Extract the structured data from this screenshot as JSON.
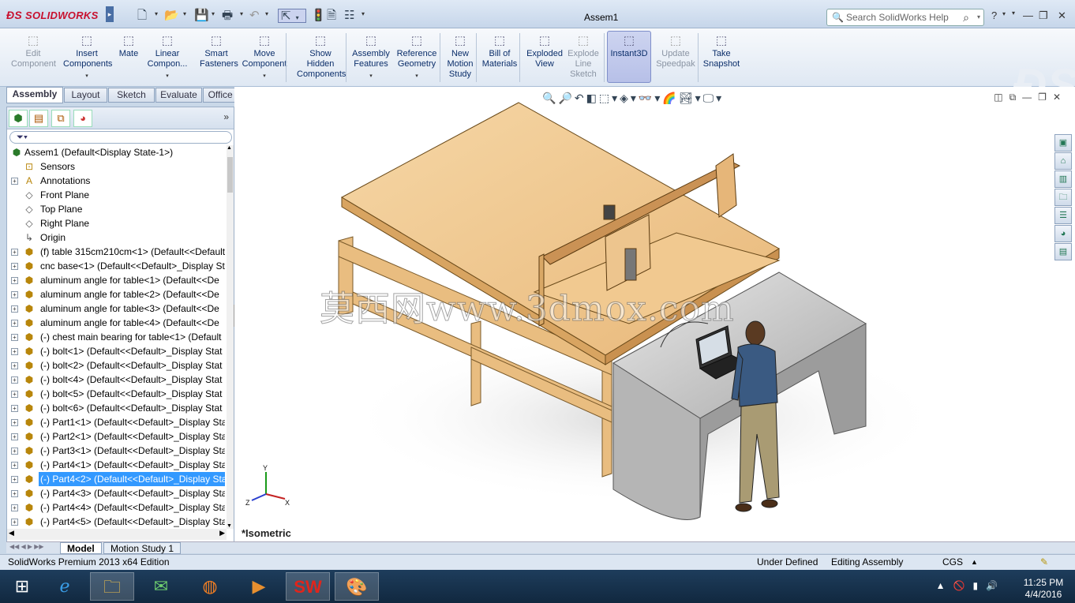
{
  "app": {
    "title": "Assem1",
    "brand": "SOLIDWORKS",
    "edition": "SolidWorks Premium 2013 x64 Edition"
  },
  "search": {
    "placeholder": "Search SolidWorks Help"
  },
  "command_manager": {
    "tools": [
      {
        "label1": "Edit",
        "label2": "Component",
        "label3": "",
        "icon": "edit-component-icon",
        "disabled": true
      },
      {
        "label1": "Insert",
        "label2": "Components",
        "label3": "",
        "icon": "insert-components-icon",
        "dropdown": true
      },
      {
        "label1": "Mate",
        "label2": "",
        "label3": "",
        "icon": "mate-icon"
      },
      {
        "label1": "Linear",
        "label2": "Compon...",
        "label3": "",
        "icon": "linear-pattern-icon",
        "dropdown": true
      },
      {
        "label1": "Smart",
        "label2": "Fasteners",
        "label3": "",
        "icon": "smart-fasteners-icon"
      },
      {
        "label1": "Move",
        "label2": "Component",
        "label3": "",
        "icon": "move-component-icon",
        "dropdown": true
      },
      {
        "label1": "Show",
        "label2": "Hidden",
        "label3": "Components",
        "icon": "show-hidden-icon"
      },
      {
        "label1": "Assembly",
        "label2": "Features",
        "label3": "",
        "icon": "assembly-features-icon",
        "dropdown": true
      },
      {
        "label1": "Reference",
        "label2": "Geometry",
        "label3": "",
        "icon": "reference-geometry-icon",
        "dropdown": true
      },
      {
        "label1": "New",
        "label2": "Motion",
        "label3": "Study",
        "icon": "motion-study-icon"
      },
      {
        "label1": "Bill of",
        "label2": "Materials",
        "label3": "",
        "icon": "bom-icon"
      },
      {
        "label1": "Exploded",
        "label2": "View",
        "label3": "",
        "icon": "exploded-view-icon"
      },
      {
        "label1": "Explode",
        "label2": "Line",
        "label3": "Sketch",
        "icon": "explode-line-icon",
        "disabled": true
      },
      {
        "label1": "Instant3D",
        "label2": "",
        "label3": "",
        "icon": "instant3d-icon",
        "active": true
      },
      {
        "label1": "Update",
        "label2": "Speedpak",
        "label3": "",
        "icon": "speedpak-icon",
        "disabled": true
      },
      {
        "label1": "Take",
        "label2": "Snapshot",
        "label3": "",
        "icon": "snapshot-icon"
      }
    ],
    "tabs": [
      "Assembly",
      "Layout",
      "Sketch",
      "Evaluate",
      "Office Products"
    ]
  },
  "tree": {
    "root": "Assem1  (Default<Display State-1>)",
    "items": [
      {
        "label": "Sensors",
        "icon": "sensors-icon",
        "expand": false
      },
      {
        "label": "Annotations",
        "icon": "annotations-icon",
        "expand": true
      },
      {
        "label": "Front Plane",
        "icon": "plane-icon",
        "expand": false
      },
      {
        "label": "Top Plane",
        "icon": "plane-icon",
        "expand": false
      },
      {
        "label": "Right Plane",
        "icon": "plane-icon",
        "expand": false
      },
      {
        "label": "Origin",
        "icon": "origin-icon",
        "expand": false
      },
      {
        "label": "(f) table 315cm210cm<1> (Default<<Default",
        "icon": "part-icon",
        "expand": true
      },
      {
        "label": "cnc base<1> (Default<<Default>_Display St",
        "icon": "part-icon",
        "expand": true
      },
      {
        "label": "aluminum angle for table<1> (Default<<De",
        "icon": "part-icon",
        "expand": true
      },
      {
        "label": "aluminum angle for table<2> (Default<<De",
        "icon": "part-icon",
        "expand": true
      },
      {
        "label": "aluminum angle for table<3> (Default<<De",
        "icon": "part-icon",
        "expand": true
      },
      {
        "label": "aluminum angle for table<4> (Default<<De",
        "icon": "part-icon",
        "expand": true
      },
      {
        "label": "(-) chest main bearing for table<1> (Default",
        "icon": "part-icon",
        "expand": true
      },
      {
        "label": "(-) bolt<1> (Default<<Default>_Display Stat",
        "icon": "part-icon",
        "expand": true
      },
      {
        "label": "(-) bolt<2> (Default<<Default>_Display Stat",
        "icon": "part-icon",
        "expand": true
      },
      {
        "label": "(-) bolt<4> (Default<<Default>_Display Stat",
        "icon": "part-icon",
        "expand": true
      },
      {
        "label": "(-) bolt<5> (Default<<Default>_Display Stat",
        "icon": "part-icon",
        "expand": true
      },
      {
        "label": "(-) bolt<6> (Default<<Default>_Display Stat",
        "icon": "part-icon",
        "expand": true
      },
      {
        "label": "(-) Part1<1> (Default<<Default>_Display Sta",
        "icon": "part-icon",
        "expand": true
      },
      {
        "label": "(-) Part2<1> (Default<<Default>_Display Sta",
        "icon": "part-icon",
        "expand": true
      },
      {
        "label": "(-) Part3<1> (Default<<Default>_Display Sta",
        "icon": "part-icon",
        "expand": true
      },
      {
        "label": "(-) Part4<1> (Default<<Default>_Display Sta",
        "icon": "part-icon",
        "expand": true
      },
      {
        "label": "(-) Part4<2> (Default<<Default>_Display Sta",
        "icon": "part-icon",
        "expand": true,
        "selected": true
      },
      {
        "label": "(-) Part4<3> (Default<<Default>_Display Sta",
        "icon": "part-icon",
        "expand": true
      },
      {
        "label": "(-) Part4<4> (Default<<Default>_Display Sta",
        "icon": "part-icon",
        "expand": true
      },
      {
        "label": "(-) Part4<5> (Default<<Default>_Display Sta",
        "icon": "part-icon",
        "expand": true
      }
    ]
  },
  "bottom_tabs": [
    "Model",
    "Motion Study 1"
  ],
  "viewport": {
    "view_label": "*Isometric",
    "watermark": "莫西网www.3dmox.com",
    "axis_x": "X",
    "axis_y": "Y",
    "axis_z": "Z"
  },
  "status": {
    "state": "Under Defined",
    "mode": "Editing Assembly",
    "units": "CGS"
  },
  "clock": {
    "time": "11:25 PM",
    "date": "4/4/2016"
  }
}
